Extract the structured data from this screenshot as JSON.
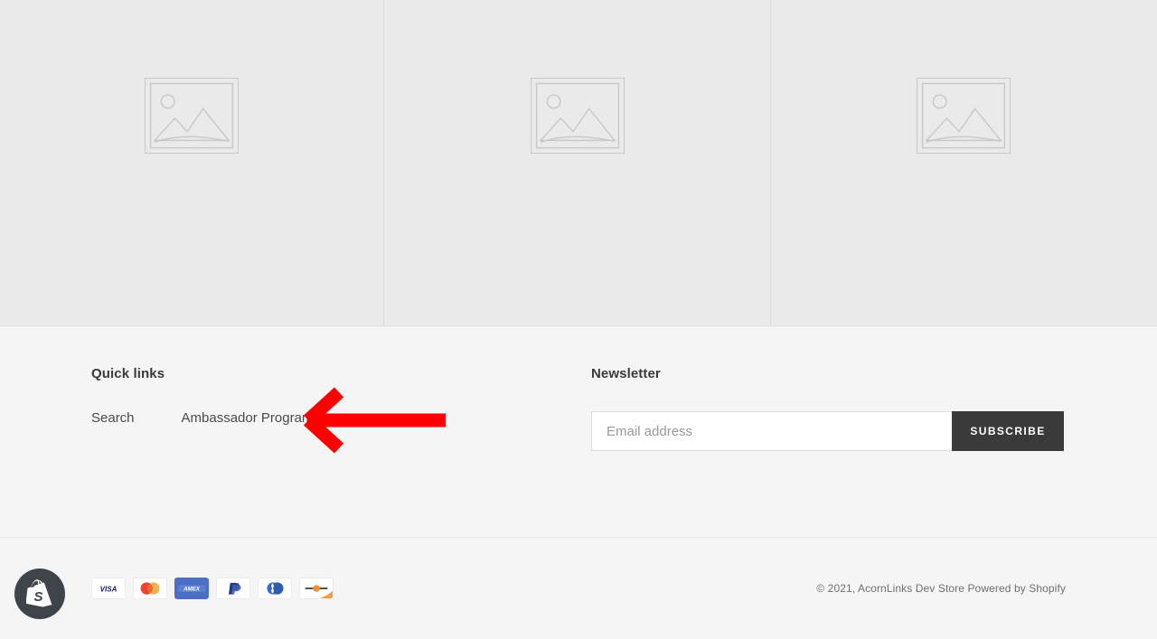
{
  "gallery": {
    "cells": [
      {
        "placeholder_icon": "image-placeholder-icon"
      },
      {
        "placeholder_icon": "image-placeholder-icon"
      },
      {
        "placeholder_icon": "image-placeholder-icon"
      }
    ]
  },
  "footer": {
    "quick_links": {
      "heading": "Quick links",
      "links": [
        {
          "label": "Search"
        },
        {
          "label": "Ambassador Program"
        }
      ]
    },
    "newsletter": {
      "heading": "Newsletter",
      "email_placeholder": "Email address",
      "email_value": "",
      "subscribe_label": "SUBSCRIBE"
    },
    "payment_methods": [
      {
        "name": "visa",
        "label": "VISA"
      },
      {
        "name": "mastercard",
        "label": "Mastercard"
      },
      {
        "name": "amex",
        "label": "AMEX"
      },
      {
        "name": "paypal",
        "label": "PayPal"
      },
      {
        "name": "diners-club",
        "label": "Diners Club"
      },
      {
        "name": "discover",
        "label": "Discover"
      }
    ],
    "copyright": "© 2021, AcornLinks Dev Store Powered by Shopify",
    "shopify_badge": "shopify-bag-icon"
  },
  "annotation": {
    "arrow": {
      "name": "red-left-arrow",
      "color": "#ff0000",
      "direction": "left"
    }
  },
  "colors": {
    "gallery_bg": "#eaeaea",
    "footer_bg": "#f5f5f5",
    "button_bg": "#3a3a3a",
    "heading_text": "#3a3a3a",
    "link_text": "#4a4a4a",
    "annotation_red": "#ff0000",
    "shopify_badge_bg": "#3f444b"
  }
}
